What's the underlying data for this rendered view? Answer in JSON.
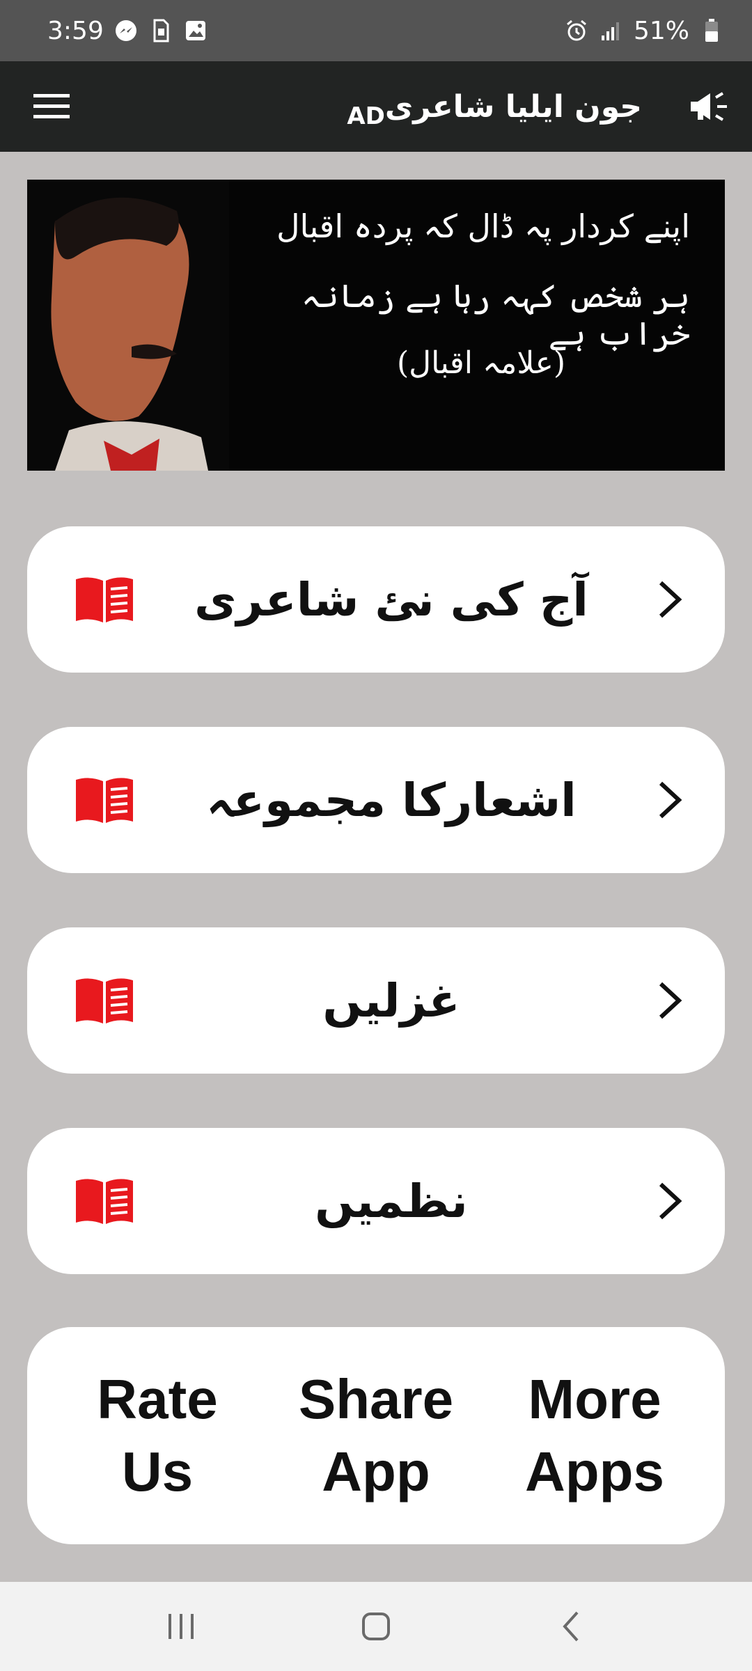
{
  "status_bar": {
    "time": "3:59",
    "battery_percent": "51%",
    "battery_level": 0.51,
    "left_icons": [
      "messenger-icon",
      "sim-card-icon",
      "gallery-icon"
    ],
    "right_icons": [
      "alarm-icon",
      "signal-icon",
      "battery-icon"
    ]
  },
  "app_bar": {
    "title": "جون ایلیا شاعری",
    "ad_label": "AD",
    "menu_icon": "hamburger-menu-icon",
    "speaker_icon": "megaphone-icon"
  },
  "banner": {
    "line1": "اپنے کردار پہ ڈال کہ پردہ اقبال",
    "line2": "ہر شخص کہہ رہا ہے زمانہ خراب ہے",
    "signature": "(علامہ اقبال)"
  },
  "menu_items": [
    {
      "label": "آج کی نئ شاعری",
      "icon": "book-icon"
    },
    {
      "label": "اشعارکا مجموعہ",
      "icon": "book-icon"
    },
    {
      "label": "غزلیں",
      "icon": "book-icon"
    },
    {
      "label": "نظمیں",
      "icon": "book-icon"
    }
  ],
  "actions": {
    "rate": "Rate\nUs",
    "share": "Share\nApp",
    "more": "More\nApps"
  },
  "colors": {
    "background": "#c3c0bf",
    "app_bar": "#222423",
    "status_bar": "#545454",
    "book_icon": "#e8191e",
    "card": "#ffffff"
  },
  "nav_bar": {
    "buttons": [
      "recents-icon",
      "home-icon",
      "back-icon"
    ]
  }
}
